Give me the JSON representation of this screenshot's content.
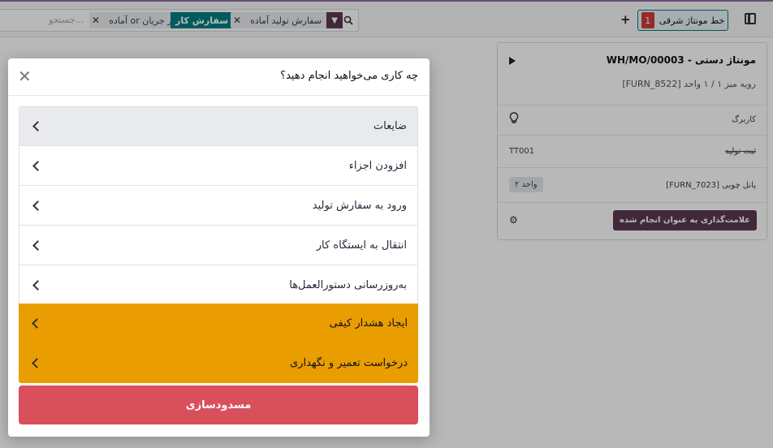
{
  "topbar": {
    "search_placeholder": "جستجو...",
    "facets": [
      {
        "icon": "filter-icon",
        "label": "سفارش تولید آماده",
        "color": "#5b3a51"
      },
      {
        "icon": "filter-icon",
        "label": "سفارش کار",
        "color": "#017e84"
      },
      {
        "label": "آماده or در جریان"
      }
    ],
    "workcenter_label": "خط مونتاژ شرقی",
    "workcenter_count": "1"
  },
  "card": {
    "title": "WH/MO/00003 - مونتاژ دستی",
    "subtitle": "[FURN_8522] رویه میز ۱ / ۱ واحد",
    "rows": [
      {
        "label": "کاربرگ",
        "icon": "lightbulb-icon"
      },
      {
        "label": "ثبت تولید",
        "value": "TT001"
      },
      {
        "label": "[FURN_7023] پانل چوبی",
        "qty": "۲ واحد"
      },
      {
        "button": "علامت‌گذاری به عنوان انجام شده",
        "icon": "gear-icon"
      }
    ]
  },
  "dialog": {
    "title": "چه کاری می‌خواهید انجام دهید؟",
    "options": [
      "ضایعات",
      "افزودن اجزاء",
      "ورود به سفارش تولید",
      "انتقال به ایستگاه کار",
      "به‌روزرسانی دستورالعمل‌ها",
      "ایجاد هشدار کیفی",
      "درخواست تعمیر و نگهداری"
    ],
    "block_label": "مسدودسازی",
    "colors": {
      "warning": "#e99d00",
      "danger": "#d94f5c",
      "primary": "#5b3a51",
      "teal": "#017e84"
    }
  }
}
